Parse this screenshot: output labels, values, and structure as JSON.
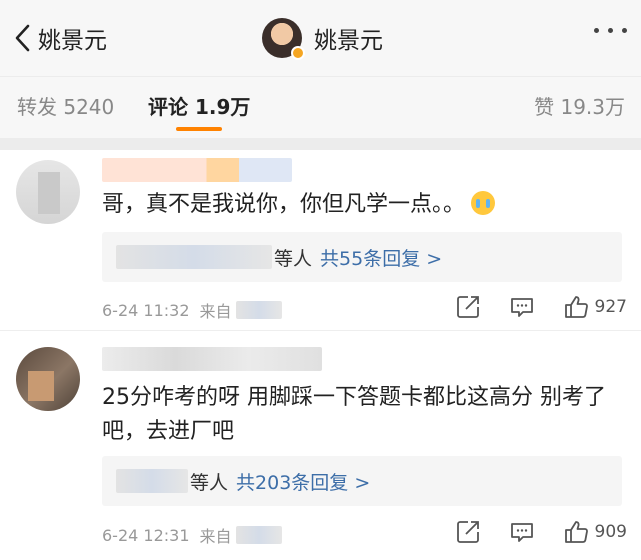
{
  "nav": {
    "back_label": "姚景元",
    "title": "姚景元"
  },
  "tabs": [
    {
      "label": "转发 5240"
    },
    {
      "label": "评论 1.9万"
    },
    {
      "label": "赞 19.3万"
    }
  ],
  "comments": [
    {
      "text": "哥，真不是我说你，你但凡学一点。。",
      "reply_by": "等人",
      "reply_link": "共55条回复 >",
      "time": "6-24 11:32",
      "source_prefix": "来自",
      "likes": "927"
    },
    {
      "text": "25分咋考的呀 用脚踩一下答题卡都比这高分 别考了吧，去进厂吧",
      "reply_by": "等人",
      "reply_link": "共203条回复 >",
      "time": "6-24 12:31",
      "source_prefix": "来自",
      "likes": "909"
    }
  ],
  "colors": {
    "accent": "#ff8200",
    "link": "#3d6ea8",
    "verified_badge": "#f5a623"
  },
  "icons": {
    "back": "chevron-left-icon",
    "more": "more-dots-icon",
    "share": "share-icon",
    "comment": "comment-icon",
    "like": "thumbs-up-icon",
    "emoji": "crying-face-icon"
  }
}
